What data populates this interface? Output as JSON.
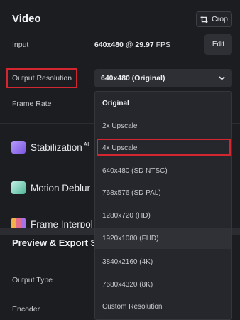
{
  "video": {
    "title": "Video",
    "crop_label": "Crop",
    "input_label": "Input",
    "input_resolution": "640x480",
    "input_at": "@",
    "input_fps_value": "29.97",
    "input_fps_unit": "FPS",
    "edit_label": "Edit",
    "output_resolution_label": "Output Resolution",
    "output_resolution_value": "640x480 (Original)",
    "frame_rate_label": "Frame Rate"
  },
  "sections": {
    "stabilization": "Stabilization",
    "stabilization_badge": "AI",
    "motion_deblur": "Motion Deblur",
    "frame_interpolation": "Frame Interpol"
  },
  "preview": {
    "title": "Preview & Export S",
    "output_type_label": "Output Type",
    "encoder_label": "Encoder"
  },
  "dropdown": {
    "selected": "Original",
    "hovered": "1920x1080 (FHD)",
    "highlighted": "4x Upscale",
    "options": [
      "Original",
      "2x Upscale",
      "4x Upscale",
      "640x480 (SD NTSC)",
      "768x576 (SD PAL)",
      "1280x720 (HD)",
      "1920x1080 (FHD)",
      "3840x2160 (4K)",
      "7680x4320 (8K)",
      "Custom Resolution"
    ]
  },
  "colors": {
    "background": "#1c1d21",
    "annotation_red": "#d32630",
    "stabilization_icon": "#8e6fe6",
    "motion_deblur_icon": "#6fd0b6",
    "frame_interp_icon": "#e48a3a"
  }
}
